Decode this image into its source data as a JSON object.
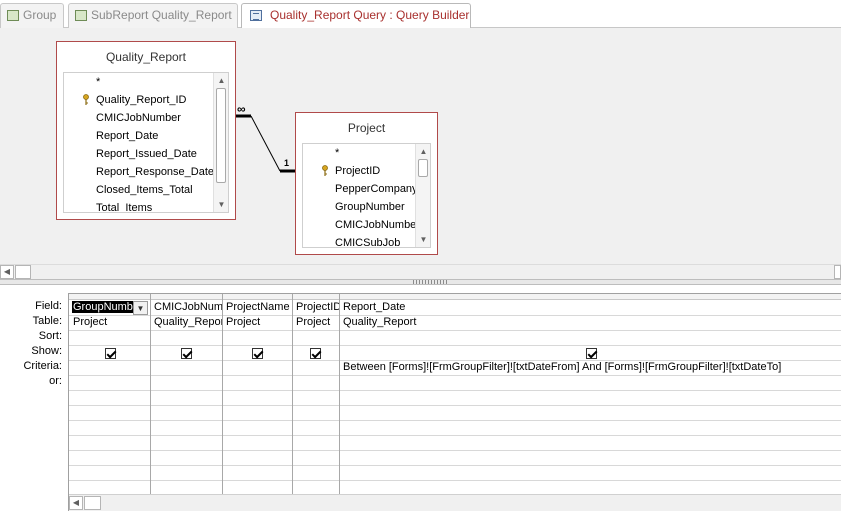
{
  "tabs": [
    {
      "label": "Group"
    },
    {
      "label": "SubReport Quality_Report"
    },
    {
      "label": "Quality_Report Query : Query Builder"
    }
  ],
  "tables": {
    "quality_report": {
      "title": "Quality_Report",
      "fields": [
        "*",
        "Quality_Report_ID",
        "CMICJobNumber",
        "Report_Date",
        "Report_Issued_Date",
        "Report_Response_Date",
        "Closed_Items_Total",
        "Total_Items"
      ]
    },
    "project": {
      "title": "Project",
      "fields": [
        "*",
        "ProjectID",
        "PepperCompanyID",
        "GroupNumber",
        "CMICJobNumber",
        "CMICSubJob"
      ]
    }
  },
  "relationship": {
    "many_symbol": "∞",
    "one_symbol": "1"
  },
  "grid": {
    "row_labels": {
      "field": "Field:",
      "table": "Table:",
      "sort": "Sort:",
      "show": "Show:",
      "criteria": "Criteria:",
      "or": "or:"
    },
    "columns": [
      {
        "field": "GroupNumber",
        "table": "Project",
        "show": true,
        "criteria": ""
      },
      {
        "field": "CMICJobNumber",
        "table": "Quality_Report",
        "show": true,
        "criteria": ""
      },
      {
        "field": "ProjectName",
        "table": "Project",
        "show": true,
        "criteria": ""
      },
      {
        "field": "ProjectID",
        "table": "Project",
        "show": true,
        "criteria": ""
      },
      {
        "field": "Report_Date",
        "table": "Quality_Report",
        "show": true,
        "criteria": "Between [Forms]![FrmGroupFilter]![txtDateFrom] And [Forms]![FrmGroupFilter]![txtDateTo]"
      }
    ]
  },
  "icons": {
    "key": "primary-key-icon",
    "scroll_up": "▲",
    "scroll_down": "▼",
    "scroll_left": "◀",
    "dropdown": "▼"
  },
  "colors": {
    "table_border": "#b04a4a",
    "active_tab_text": "#a8302e"
  }
}
